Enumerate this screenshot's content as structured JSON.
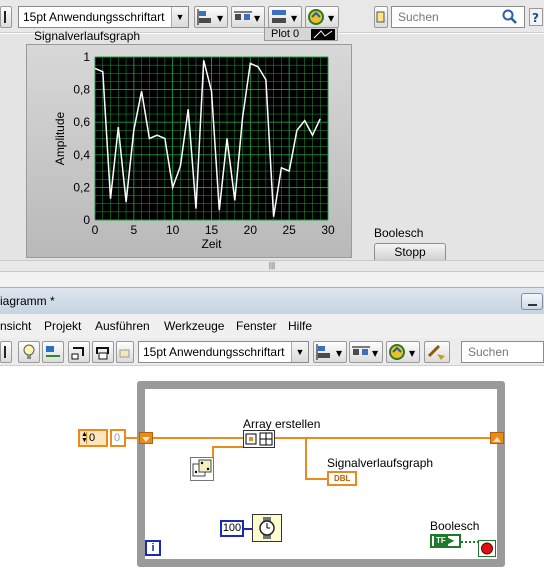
{
  "front_panel": {
    "toolbar": {
      "font_combo": "15pt Anwendungsschriftart",
      "search_placeholder": "Suchen"
    },
    "plot_legend": "Plot 0",
    "graph": {
      "title": "Signalverlaufsgraph",
      "xlabel": "Zeit",
      "ylabel": "Amplitude"
    },
    "boolean": {
      "label": "Boolesch",
      "button_text": "Stopp"
    }
  },
  "block_diagram": {
    "window_title": "iagramm *",
    "menu": [
      "nsicht",
      "Projekt",
      "Ausführen",
      "Werkzeuge",
      "Fenster",
      "Hilfe"
    ],
    "toolbar": {
      "font_combo": "15pt Anwendungsschriftart",
      "search_placeholder": "Suchen"
    },
    "nodes": {
      "control_value": "0",
      "indicator_value": "0",
      "build_array_label": "Array erstellen",
      "graph_terminal_label": "Signalverlaufsgraph",
      "graph_terminal_type": "DBL",
      "wait_constant": "100",
      "boolean_label": "Boolesch",
      "boolean_terminal_type": "TF",
      "iteration_terminal": "i"
    }
  },
  "colors": {
    "plot_background": "#000000",
    "grid": "#1aa040",
    "trace": "#ffffff",
    "wire_numeric": "#e98a1c",
    "wire_boolean": "#1d7a2a"
  },
  "chart_data": {
    "type": "line",
    "title": "Signalverlaufsgraph",
    "xlabel": "Zeit",
    "ylabel": "Amplitude",
    "xlim": [
      0,
      30
    ],
    "ylim": [
      0,
      1
    ],
    "x_ticks": [
      "0",
      "5",
      "10",
      "15",
      "20",
      "25",
      "30"
    ],
    "y_ticks": [
      "0",
      "0,2",
      "0,4",
      "0,6",
      "0,8",
      "1"
    ],
    "grid": true,
    "series": [
      {
        "values": [
          0.93,
          0.91,
          0.13,
          0.57,
          0.11,
          0.55,
          0.79,
          0.5,
          0.52,
          0.5,
          0.2,
          0.33,
          0.68,
          0.07,
          0.98,
          0.79,
          0.06,
          0.5,
          0.12,
          0.63,
          0.96,
          0.94,
          0.86,
          0.02,
          0.32,
          0.3,
          0.55,
          0.61,
          0.52,
          0.62
        ]
      }
    ]
  }
}
